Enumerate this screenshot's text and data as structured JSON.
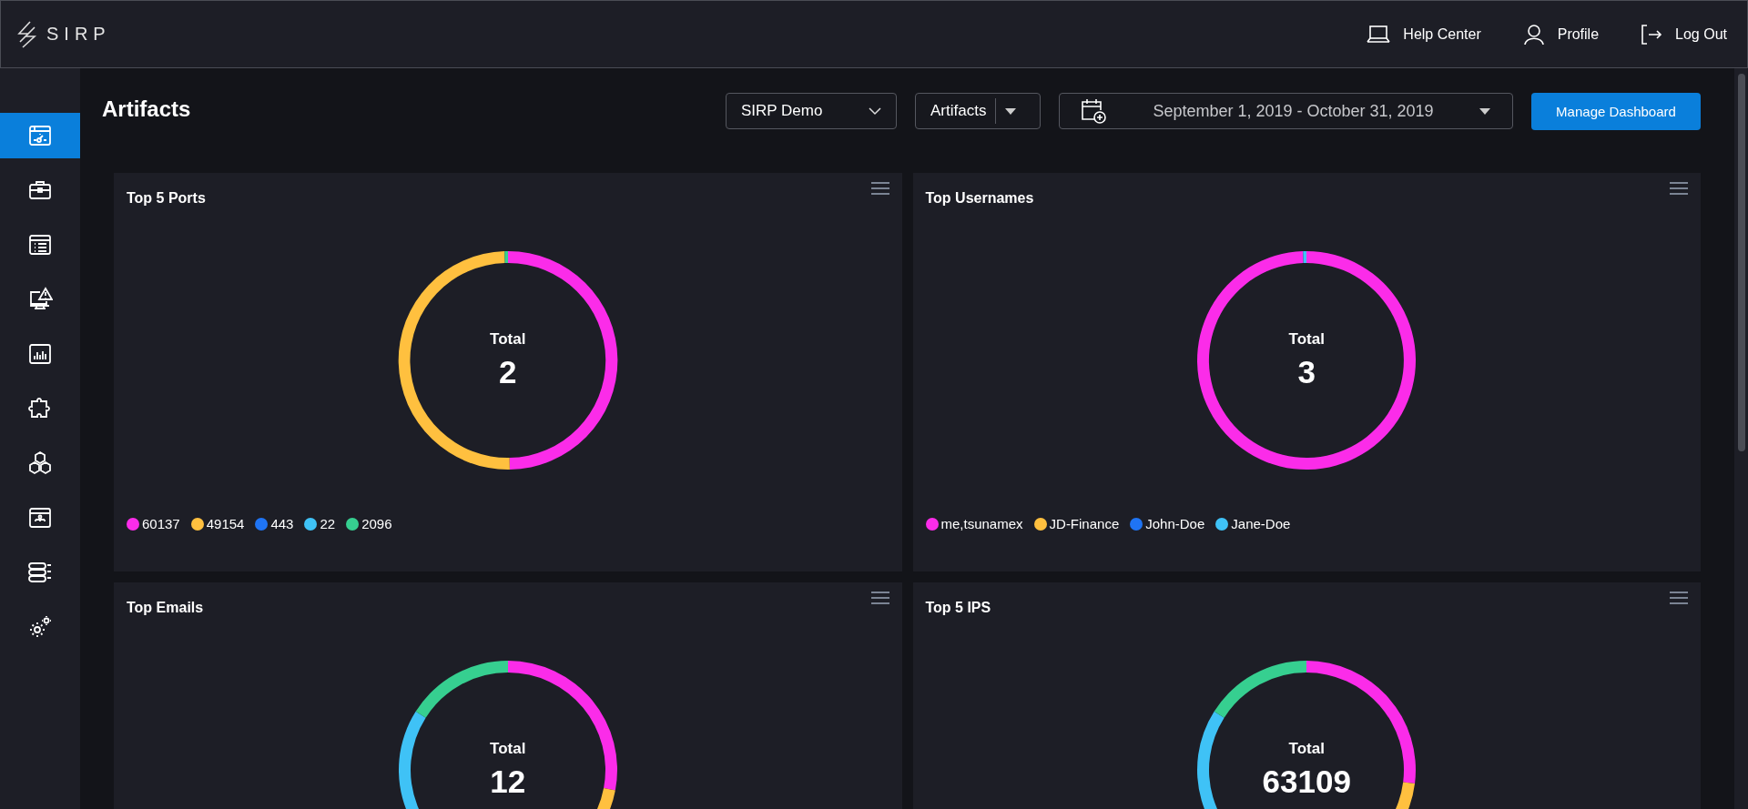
{
  "header": {
    "logo": "SIRP",
    "links": [
      {
        "kind": "help",
        "label": "Help Center"
      },
      {
        "kind": "profile",
        "label": "Profile"
      },
      {
        "kind": "logout",
        "label": "Log Out"
      }
    ]
  },
  "sidebar": {
    "items": [
      {
        "selected": true
      },
      {
        "selected": false
      },
      {
        "selected": false
      },
      {
        "selected": false
      },
      {
        "selected": false
      },
      {
        "selected": false
      },
      {
        "selected": false
      },
      {
        "selected": false
      },
      {
        "selected": false
      },
      {
        "selected": false
      }
    ]
  },
  "page": {
    "title": "Artifacts",
    "workspace": "SIRP Demo",
    "view": "Artifacts",
    "date_range": "September 1, 2019 - October 31, 2019",
    "action": "Manage Dashboard"
  },
  "cards": [
    {
      "title": "Top 5 Ports",
      "total_label": "Total",
      "total": "2",
      "chart_data": {
        "type": "donut",
        "categories": [
          "60137",
          "49154",
          "443",
          "22",
          "2096"
        ],
        "values": [
          49.75,
          49.75,
          0,
          0,
          0.5
        ]
      },
      "legend": [
        {
          "color": "#fb2ce9"
        },
        {
          "color": "#ffc03f"
        },
        {
          "color": "#1f74f4"
        },
        {
          "color": "#3fc2f6"
        },
        {
          "color": "#36cf90"
        }
      ]
    },
    {
      "title": "Top Usernames",
      "total_label": "Total",
      "total": "3",
      "chart_data": {
        "type": "donut",
        "categories": [
          "me,tsunamex",
          "JD-Finance",
          "John-Doe",
          "Jane-Doe"
        ],
        "values": [
          99.5,
          0,
          0,
          0.5
        ]
      },
      "legend": [
        {
          "color": "#fb2ce9"
        },
        {
          "color": "#ffc03f"
        },
        {
          "color": "#1f74f4"
        },
        {
          "color": "#3fc2f6"
        }
      ]
    },
    {
      "title": "Top Emails",
      "total_label": "Total",
      "total": "12"
    },
    {
      "title": "Top 5 IPS",
      "total_label": "Total",
      "total": "63109"
    }
  ]
}
